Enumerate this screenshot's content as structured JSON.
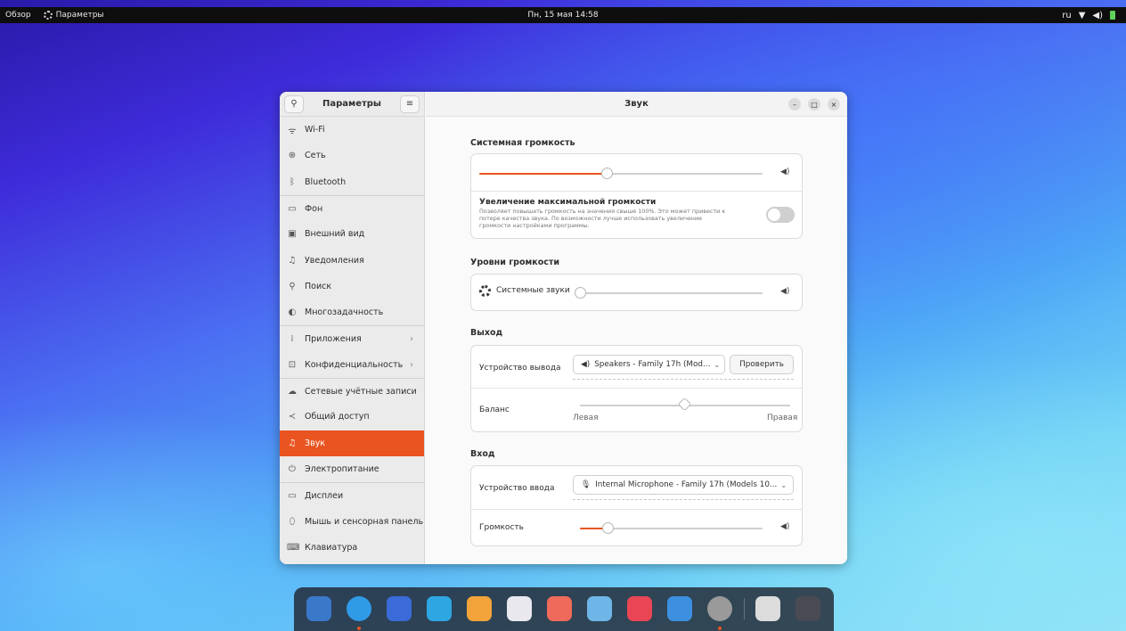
{
  "topbar": {
    "activities": "Обзор",
    "app_name": "Параметры",
    "clock": "Пн, 15 мая  14:58",
    "keyboard_layout": "ru"
  },
  "window": {
    "sidebar_title": "Параметры",
    "content_title": "Звук"
  },
  "sidebar": {
    "items": [
      {
        "label": "Wi-Fi",
        "icon": "wifi-icon",
        "glyph": "ᯤ"
      },
      {
        "label": "Сеть",
        "icon": "network-icon",
        "glyph": "⊕"
      },
      {
        "label": "Bluetooth",
        "icon": "bluetooth-icon",
        "glyph": "ᛒ"
      },
      {
        "label": "Фон",
        "icon": "background-icon",
        "glyph": "▭"
      },
      {
        "label": "Внешний вид",
        "icon": "appearance-icon",
        "glyph": "▣"
      },
      {
        "label": "Уведомления",
        "icon": "bell-icon",
        "glyph": "♫"
      },
      {
        "label": "Поиск",
        "icon": "search-icon",
        "glyph": "⚲"
      },
      {
        "label": "Многозадачность",
        "icon": "multitasking-icon",
        "glyph": "◐"
      },
      {
        "label": "Приложения",
        "icon": "apps-icon",
        "glyph": "⁞"
      },
      {
        "label": "Конфиденциальность",
        "icon": "lock-icon",
        "glyph": "⊡"
      },
      {
        "label": "Сетевые учётные записи",
        "icon": "cloud-icon",
        "glyph": "☁"
      },
      {
        "label": "Общий доступ",
        "icon": "share-icon",
        "glyph": "≺"
      },
      {
        "label": "Звук",
        "icon": "music-note-icon",
        "glyph": "♫"
      },
      {
        "label": "Электропитание",
        "icon": "power-icon",
        "glyph": "⏻"
      },
      {
        "label": "Дисплеи",
        "icon": "display-icon",
        "glyph": "▭"
      },
      {
        "label": "Мышь и сенсорная панель",
        "icon": "mouse-icon",
        "glyph": "⬯"
      },
      {
        "label": "Клавиатура",
        "icon": "keyboard-icon",
        "glyph": "⌨"
      }
    ]
  },
  "sound": {
    "system_volume": {
      "title": "Системная громкость",
      "level": 0.45,
      "overamp_title": "Увеличение максимальной громкости",
      "overamp_desc_1": "Позволяет повышать громкость на значения свыше 100%. Это может привести к",
      "overamp_desc_2": "потере качества звука. По возможности лучше использовать увеличение",
      "overamp_desc_3": "громкости настройками программы.",
      "overamp_enabled": false
    },
    "levels": {
      "title": "Уровни громкости",
      "system_sounds_label": "Системные звуки",
      "system_sounds_level": 0.0
    },
    "output": {
      "title": "Выход",
      "device_label": "Устройство вывода",
      "device_value": "Speakers - Family 17h (Mod...",
      "test_button": "Проверить",
      "balance_label": "Баланс",
      "balance_left": "Левая",
      "balance_right": "Правая",
      "balance": 0.5
    },
    "input": {
      "title": "Вход",
      "device_label": "Устройство ввода",
      "device_value": "Internal Microphone - Family 17h (Models 10...",
      "volume_label": "Громкость",
      "volume_level": 0.15
    }
  },
  "dock": {
    "apps": [
      "files-icon",
      "chromium-icon",
      "thunderbird-icon",
      "telegram-icon",
      "krita-icon",
      "notes-icon",
      "calendar-icon",
      "passwords-icon",
      "music-icon",
      "software-icon",
      "settings-icon",
      "trash-icon",
      "app-grid-icon"
    ],
    "colors": [
      "#3a78c9",
      "#2f9be6",
      "#3a6bd8",
      "#2ea6e2",
      "#f2a33a",
      "#e8e8ee",
      "#ef6a5a",
      "#6fb6e8",
      "#e94554",
      "#3d8fe0",
      "#9a9a9a",
      "#dcdcdc",
      "#4a4a55"
    ]
  },
  "colors": {
    "accent": "#e95420"
  }
}
